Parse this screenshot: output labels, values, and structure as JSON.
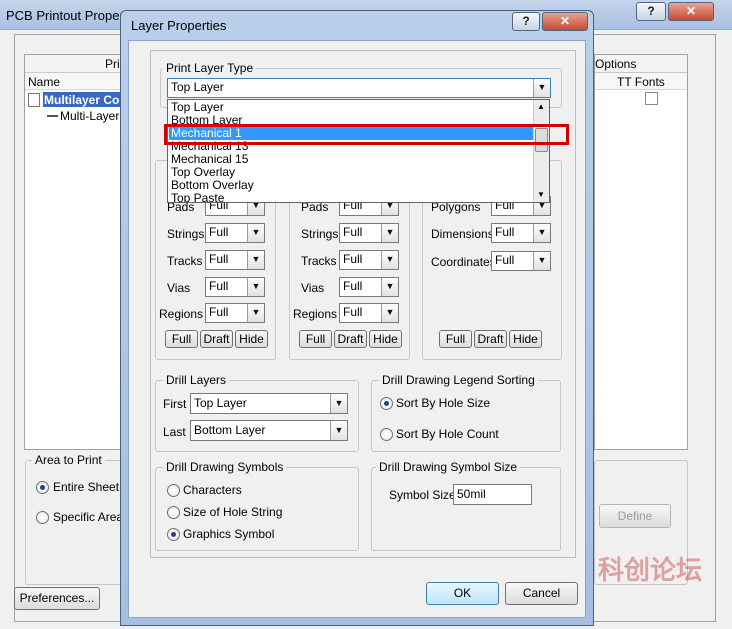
{
  "background_window": {
    "title": "PCB Printout Properties",
    "tree_header_name": "Name",
    "tree_header_print": "Print",
    "tree_items": [
      "Multilayer Comp",
      "Multi-Layer"
    ],
    "options_header": "Options",
    "tt_fonts_label": "TT Fonts",
    "area_to_print": {
      "legend": "Area to Print",
      "entire_sheet": "Entire Sheet",
      "specific_area": "Specific Area"
    },
    "define_label": "Define",
    "preferences_label": "Preferences...",
    "title_buttons": {
      "help": "?",
      "close": "✕"
    }
  },
  "dialog": {
    "title": "Layer Properties",
    "title_buttons": {
      "help": "?",
      "close": "✕"
    },
    "print_layer_type": {
      "legend": "Print Layer Type",
      "selected": "Top Layer",
      "options": [
        "Top Layer",
        "Bottom Layer",
        "Mechanical 1",
        "Mechanical 13",
        "Mechanical 15",
        "Top Overlay",
        "Bottom Overlay",
        "Top Paste"
      ],
      "highlighted": "Mechanical 1"
    },
    "col1": {
      "rows": [
        {
          "label": "Pads",
          "value": "Full"
        },
        {
          "label": "Strings",
          "value": "Full"
        },
        {
          "label": "Tracks",
          "value": "Full"
        },
        {
          "label": "Vias",
          "value": "Full"
        },
        {
          "label": "Regions",
          "value": "Full"
        }
      ]
    },
    "col2": {
      "rows": [
        {
          "label": "Pads",
          "value": "Full"
        },
        {
          "label": "Strings",
          "value": "Full"
        },
        {
          "label": "Tracks",
          "value": "Full"
        },
        {
          "label": "Vias",
          "value": "Full"
        },
        {
          "label": "Regions",
          "value": "Full"
        }
      ]
    },
    "col3": {
      "rows": [
        {
          "label": "Polygons",
          "value": "Full"
        },
        {
          "label": "Dimensions",
          "value": "Full"
        },
        {
          "label": "Coordinates",
          "value": "Full"
        }
      ]
    },
    "mode_buttons": {
      "full": "Full",
      "draft": "Draft",
      "hide": "Hide"
    },
    "drill_layers": {
      "legend": "Drill Layers",
      "first_label": "First",
      "first_value": "Top Layer",
      "last_label": "Last",
      "last_value": "Bottom Layer"
    },
    "legend_sorting": {
      "legend": "Drill Drawing Legend Sorting",
      "by_hole_size": "Sort By Hole Size",
      "by_hole_count": "Sort By Hole Count"
    },
    "drill_symbols": {
      "legend": "Drill Drawing Symbols",
      "characters": "Characters",
      "size_of_hole_string": "Size of Hole String",
      "graphics_symbol": "Graphics Symbol"
    },
    "symbol_size": {
      "legend": "Drill Drawing Symbol Size",
      "label": "Symbol Size",
      "value": "50mil"
    },
    "ok_label": "OK",
    "cancel_label": "Cancel"
  },
  "watermark": "科创论坛"
}
